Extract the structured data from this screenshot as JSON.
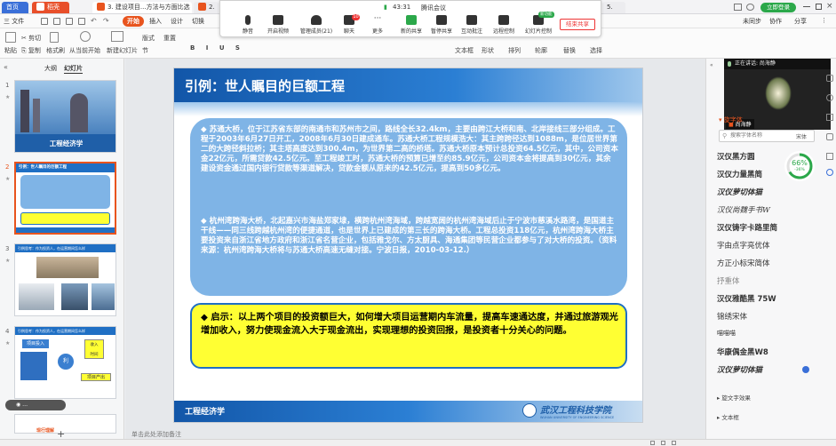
{
  "titlebar": {
    "tabs": [
      "首页",
      "稻壳",
      "3. 建设项目...方法与方面比选",
      "2.",
      "5."
    ],
    "login": "立即登录"
  },
  "menubar": {
    "file": "三 文件",
    "items": [
      "开始",
      "插入",
      "设计",
      "切换"
    ],
    "right": [
      "未同步",
      "协作",
      "分享"
    ]
  },
  "ribbon": {
    "paste": "粘贴",
    "cut": "剪切",
    "copy": "复制",
    "format": "格式刷",
    "from_current": "从当前开始",
    "new_slide": "新建幻灯片",
    "layout": "版式",
    "section": "节",
    "reset": "重置",
    "textbox": "文本框",
    "shape": "形状",
    "arrange": "排列",
    "outline": "轮廓",
    "replace": "替换",
    "select": "选择"
  },
  "meeting": {
    "signal": "43:31",
    "title": "腾讯会议",
    "buttons": [
      "静音",
      "开启视频",
      "管理成员(21)",
      "聊天",
      "更多",
      "新的共享",
      "暂停共享",
      "互动批注",
      "远程控制",
      "幻灯片控制"
    ],
    "end": "结束共享",
    "chat_badge": "10",
    "slide_badge": "新功能"
  },
  "leftpanel": {
    "tabs": [
      "大纲",
      "幻灯片"
    ],
    "slides": [
      {
        "num": "1",
        "title": "工程经济学"
      },
      {
        "num": "2",
        "title": "引例：世人瞩目的巨额工程"
      },
      {
        "num": "3",
        "title": "引例思考：作为投资人，在运营期间怎么样"
      },
      {
        "num": "4",
        "title": "引例思考：作为投资人，在运营期间怎么样"
      },
      {
        "num": "5",
        "title": "现行理解"
      }
    ],
    "slide4_labels": [
      "项目投入",
      "利",
      "收入",
      "时间",
      "项目产出"
    ],
    "notes": "单击此处添加备注"
  },
  "slide": {
    "title": "引例：世人瞩目的巨额工程",
    "p1": "苏通大桥，位于江苏省东部的南通市和苏州市之间，路线全长32.4km，主要由跨江大桥和南、北岸接线三部分组成。工程于2003年6月27日开工，2008年6月30日建成通车。苏通大桥工程规模浩大：其主跨跨径达到1088m，是位居世界第二的大跨径斜拉桥；其主塔高度达到300.4m，为世界第二高的桥塔。苏通大桥原本预计总投资64.5亿元，其中，公司资本金22亿元，所需贷款42.5亿元。至工程竣工时，苏通大桥的预算已增至约85.9亿元，公司资本金将提高到30亿元，其余建设资金通过国内银行贷款等渠道解决，贷款金额从原来的42.5亿元，提高到50多亿元。",
    "p2": "杭州湾跨海大桥，北起嘉兴市海盐郑家埭，横跨杭州湾海域，跨越宽阔的杭州湾海域后止于宁波市慈溪水路湾，是国道主干线——同三线跨越杭州湾的便捷通道，也是世界上已建成的第三长的跨海大桥。工程总投资118亿元，杭州湾跨海大桥主要投资来自浙江省地方政府和浙江省名营企业，包括雅戈尔、方太厨具、海通集团等民营企业都参与了对大桥的投资。（资料来源：杭州湾跨海大桥将与苏通大桥高速无缝对接。宁波日报，2010-03-12.）",
    "p3": "启示：以上两个项目的投资额巨大，如何增大项目运营期内车流量，提高车速通达度，并通过旅游观光增加收入，努力使现金流入大于现金流出，实现理想的投资回报，是投资者十分关心的问题。",
    "footer": "工程经济学",
    "logo": "武汉工程科技学院",
    "logo_en": "WUHAN UNIVERSITY OF ENGINEERING SCIENCE"
  },
  "rightpanel": {
    "speaker": "正在讲话: 尚海静",
    "name": "尚海静",
    "font_section": "旋字体",
    "search_placeholder": "搜索字体名称",
    "font_type": "宋体",
    "progress_value": "66%",
    "progress_sub": "-36%",
    "progress_fraction": 0.66,
    "fonts": [
      "汉仪黑方圆",
      "汉仪力量黑简",
      "汉仪萝切体猫",
      "汉仪尚魏手书W",
      "汉仪铸字卡路里简",
      "字由点字亮优体",
      "方正小标宋简体",
      "抒重体",
      "汉仪雅酷黑 75W",
      "锦绣宋体",
      "喵喵喵",
      "华康偶金黑W8",
      "汉仪萝切体猫"
    ],
    "sections": [
      "旋文字效果",
      "文本框"
    ]
  },
  "colors": {
    "accent_orange": "#e8541e",
    "slide_blue": "#1f6fc4",
    "box_blue": "#7fb4e6",
    "box_yellow": "#ffff33",
    "login_green": "#2ba84a"
  }
}
